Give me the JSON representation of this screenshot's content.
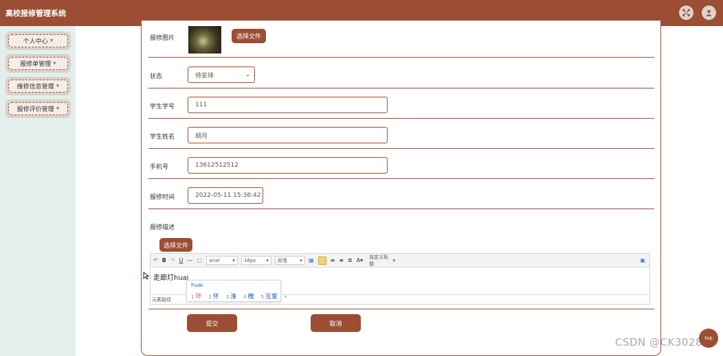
{
  "app": {
    "title": "高校报修管理系统"
  },
  "header": {
    "icons": [
      "fullscreen-icon",
      "user-icon"
    ]
  },
  "sidebar": {
    "items": [
      {
        "label": "个人中心"
      },
      {
        "label": "报修单管理"
      },
      {
        "label": "维修信息管理"
      },
      {
        "label": "报修评价管理"
      }
    ]
  },
  "form": {
    "image_label": "报修图片",
    "choose_file_label": "选择文件",
    "status_label": "状态",
    "status_value": "待安排",
    "student_id_label": "学生学号",
    "student_id_value": "111",
    "student_name_label": "学生姓名",
    "student_name_value": "胡月",
    "phone_label": "手机号",
    "phone_value": "13612512512",
    "time_label": "报修时间",
    "time_value": "2022-05-11 15:36:42",
    "desc_label": "报修描述",
    "desc_choose_file_label": "选择文件",
    "submit_label": "提交",
    "cancel_label": "取消"
  },
  "editor": {
    "font_family": "arial",
    "font_size": "16px",
    "paragraph": "段落",
    "custom_title": "自定义标题",
    "content_text": "走廊灯huai",
    "footer_text": "元素路径"
  },
  "ime": {
    "pinyin": "huai",
    "candidates": [
      {
        "num": "1",
        "text": "坏"
      },
      {
        "num": "2",
        "text": "怀"
      },
      {
        "num": "3",
        "text": "淮"
      },
      {
        "num": "4",
        "text": "槐"
      },
      {
        "num": "5",
        "text": "互爱"
      }
    ],
    "next": "›"
  },
  "watermark": "CSDN @CK3028",
  "float_button_label": "top"
}
